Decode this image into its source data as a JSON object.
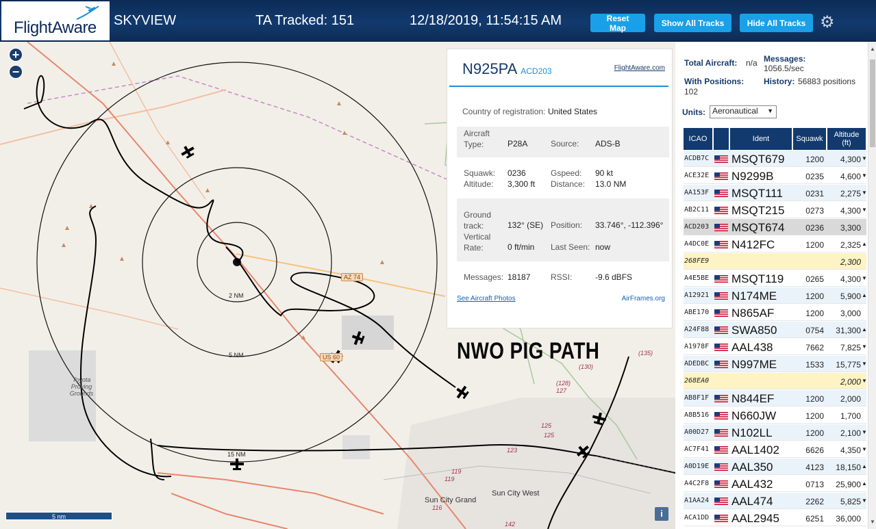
{
  "header": {
    "logo_text": "FlightAware",
    "site_name": "SKYVIEW",
    "ta_tracked": "TA Tracked: 151",
    "datetime": "12/18/2019, 11:54:15 AM",
    "reset_map": "Reset Map",
    "show_all_tracks": "Show All Tracks",
    "hide_all_tracks": "Hide All Tracks",
    "settings_icon": "gear-icon"
  },
  "map": {
    "zoom_in": "+",
    "zoom_out": "−",
    "scale_bar": "5 nm",
    "info": "i",
    "annotation": "NWO PIG PATH",
    "range_labels": [
      "2 NM",
      "5 NM",
      "15 NM"
    ],
    "towns": [
      "Sun City Grand",
      "Sun City West",
      "Toyota Proving Grounds"
    ],
    "route_shields": [
      "AZ 74",
      "US 60"
    ],
    "road_numbers": [
      "(135)",
      "(130)",
      "(128)",
      "127",
      "125",
      "125",
      "123",
      "119",
      "119",
      "116",
      "142"
    ],
    "colors": {
      "land": "#f2efe9",
      "track": "#000000",
      "highway": "#f0a060",
      "primary": "#e8866a"
    }
  },
  "popup": {
    "ident": "N925PA",
    "callsign": "ACD203",
    "fa_link": "FlightAware.com",
    "country_label": "Country of registration:",
    "country": "United States",
    "type_label": "Aircraft Type:",
    "type": "P28A",
    "source_label": "Source:",
    "source": "ADS-B",
    "squawk_label": "Squawk:",
    "squawk": "0236",
    "gspeed_label": "Gspeed:",
    "gspeed": "90 kt",
    "altitude_label": "Altitude:",
    "altitude": "3,300 ft",
    "distance_label": "Distance:",
    "distance": "13.0 NM",
    "track_label": "Ground track:",
    "track": "132° (SE)",
    "position_label": "Position:",
    "position": "33.746°, -112.396°",
    "vrate_label": "Vertical Rate:",
    "vrate": "0 ft/min",
    "lastseen_label": "Last Seen:",
    "lastseen": "now",
    "messages_label": "Messages:",
    "messages": "18187",
    "rssi_label": "RSSI:",
    "rssi": "-9.6 dBFS",
    "photos_link": "See Aircraft Photos",
    "airframes_link": "AirFrames.org"
  },
  "panel": {
    "total_label": "Total Aircraft:",
    "total_value": "n/a",
    "messages_label": "Messages:",
    "messages_value": "1056.5/sec",
    "withpos_label": "With Positions:",
    "withpos_value": "102",
    "history_label": "History:",
    "history_value": "56883 positions",
    "units_label": "Units:",
    "units_value": "Aeronautical",
    "columns": [
      "ICAO",
      "",
      "Ident",
      "Squawk",
      "Altitude (ft)"
    ],
    "rows": [
      {
        "icao": "ACDB7C",
        "flag": true,
        "ident": "MSQT679",
        "squawk": "1200",
        "alt": "4,300",
        "caret": "▼",
        "state": "alt"
      },
      {
        "icao": "ACE32E",
        "flag": true,
        "ident": "N9299B",
        "squawk": "0235",
        "alt": "4,600",
        "caret": "▼",
        "state": "normal"
      },
      {
        "icao": "AA153F",
        "flag": true,
        "ident": "MSQT111",
        "squawk": "0231",
        "alt": "2,275",
        "caret": "▼",
        "state": "alt"
      },
      {
        "icao": "AB2C11",
        "flag": true,
        "ident": "MSQT215",
        "squawk": "0273",
        "alt": "4,300",
        "caret": "▼",
        "state": "normal"
      },
      {
        "icao": "ACD203",
        "flag": true,
        "ident": "MSQT674",
        "squawk": "0236",
        "alt": "3,300",
        "caret": "",
        "state": "selected"
      },
      {
        "icao": "A4DC0E",
        "flag": true,
        "ident": "N412FC",
        "squawk": "1200",
        "alt": "2,325",
        "caret": "▲",
        "state": "normal"
      },
      {
        "icao": "268FE9",
        "flag": false,
        "ident": "",
        "squawk": "",
        "alt": "2,300",
        "caret": "",
        "state": "noloc"
      },
      {
        "icao": "A4E5BE",
        "flag": true,
        "ident": "MSQT119",
        "squawk": "0265",
        "alt": "4,300",
        "caret": "▼",
        "state": "normal"
      },
      {
        "icao": "A12921",
        "flag": true,
        "ident": "N174ME",
        "squawk": "1200",
        "alt": "5,900",
        "caret": "▲",
        "state": "alt"
      },
      {
        "icao": "ABE170",
        "flag": true,
        "ident": "N865AF",
        "squawk": "1200",
        "alt": "3,000",
        "caret": "",
        "state": "normal"
      },
      {
        "icao": "A24F88",
        "flag": true,
        "ident": "SWA850",
        "squawk": "0754",
        "alt": "31,300",
        "caret": "▲",
        "state": "alt"
      },
      {
        "icao": "A1978F",
        "flag": true,
        "ident": "AAL438",
        "squawk": "7662",
        "alt": "7,825",
        "caret": "▼",
        "state": "normal"
      },
      {
        "icao": "ADEDBC",
        "flag": true,
        "ident": "N997ME",
        "squawk": "1533",
        "alt": "15,775",
        "caret": "▼",
        "state": "alt"
      },
      {
        "icao": "268EA0",
        "flag": false,
        "ident": "",
        "squawk": "",
        "alt": "2,000",
        "caret": "▼",
        "state": "noloc"
      },
      {
        "icao": "AB8F1F",
        "flag": true,
        "ident": "N844EF",
        "squawk": "1200",
        "alt": "2,000",
        "caret": "",
        "state": "alt"
      },
      {
        "icao": "A8B516",
        "flag": true,
        "ident": "N660JW",
        "squawk": "1200",
        "alt": "1,700",
        "caret": "",
        "state": "normal"
      },
      {
        "icao": "A00D27",
        "flag": true,
        "ident": "N102LL",
        "squawk": "1200",
        "alt": "2,100",
        "caret": "▼",
        "state": "alt"
      },
      {
        "icao": "AC7F41",
        "flag": true,
        "ident": "AAL1402",
        "squawk": "6626",
        "alt": "4,350",
        "caret": "▼",
        "state": "normal"
      },
      {
        "icao": "A0D19E",
        "flag": true,
        "ident": "AAL350",
        "squawk": "4123",
        "alt": "18,150",
        "caret": "▲",
        "state": "alt"
      },
      {
        "icao": "A4C2F8",
        "flag": true,
        "ident": "AAL432",
        "squawk": "0713",
        "alt": "25,900",
        "caret": "▲",
        "state": "normal"
      },
      {
        "icao": "A1AA24",
        "flag": true,
        "ident": "AAL474",
        "squawk": "2262",
        "alt": "5,825",
        "caret": "▼",
        "state": "alt"
      },
      {
        "icao": "ACA1DD",
        "flag": true,
        "ident": "AAL2945",
        "squawk": "6251",
        "alt": "36,000",
        "caret": "",
        "state": "normal"
      }
    ]
  }
}
